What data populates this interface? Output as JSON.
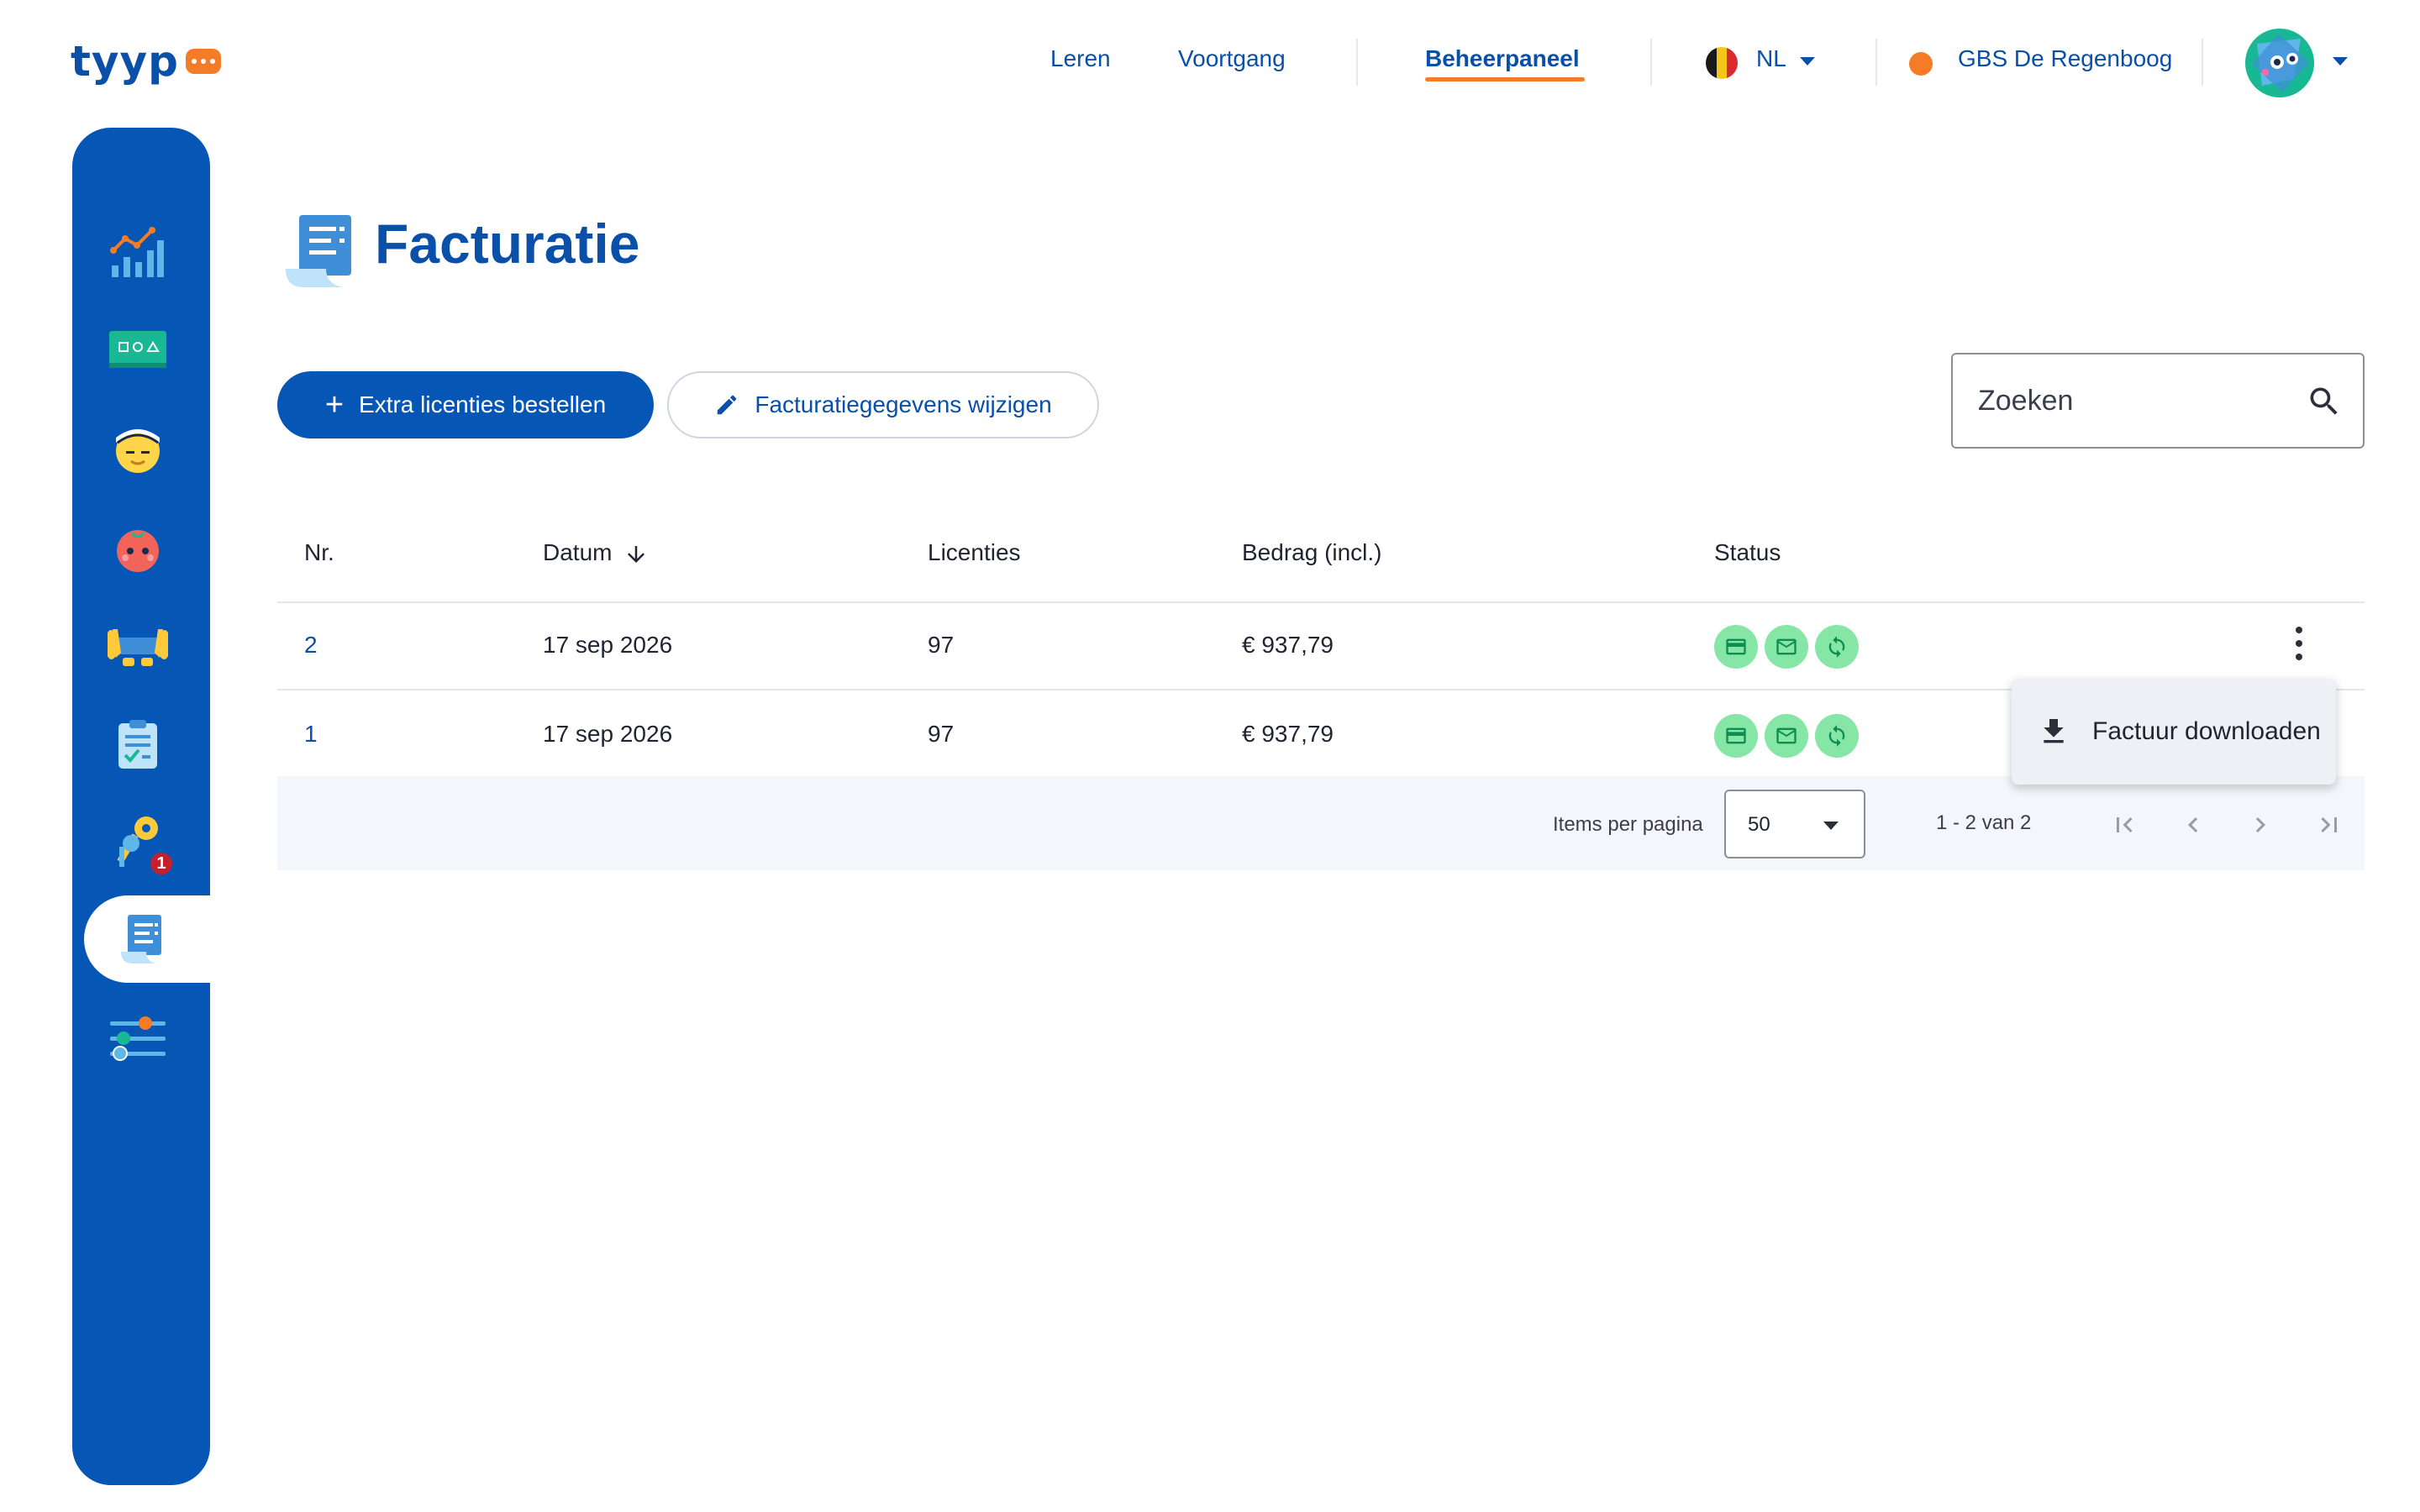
{
  "brand": {
    "name": "tyyp"
  },
  "nav": {
    "links": [
      "Leren",
      "Voortgang"
    ],
    "active": "Beheerpaneel",
    "language": "NL",
    "school": "GBS De Regenboog"
  },
  "sidebar": {
    "items": [
      {
        "name": "dashboard-icon"
      },
      {
        "name": "classroom-icon"
      },
      {
        "name": "student-icon"
      },
      {
        "name": "tomato-icon"
      },
      {
        "name": "hands-keyboard-icon"
      },
      {
        "name": "clipboard-icon"
      },
      {
        "name": "keys-icon",
        "badge": "1"
      },
      {
        "name": "invoice-icon",
        "active": true
      },
      {
        "name": "settings-sliders-icon"
      }
    ]
  },
  "page": {
    "title": "Facturatie"
  },
  "actions": {
    "order_label": "Extra licenties bestellen",
    "edit_label": "Facturatiegegevens wijzigen"
  },
  "search": {
    "placeholder": "Zoeken"
  },
  "table": {
    "columns": [
      "Nr.",
      "Datum",
      "Licenties",
      "Bedrag (incl.)",
      "Status"
    ],
    "rows": [
      {
        "nr": "2",
        "datum": "17 sep 2026",
        "licenties": "97",
        "bedrag": "€ 937,79"
      },
      {
        "nr": "1",
        "datum": "17 sep 2026",
        "licenties": "97",
        "bedrag": "€ 937,79"
      }
    ]
  },
  "paginator": {
    "items_label": "Items per pagina",
    "page_size": "50",
    "range": "1 - 2 van 2"
  },
  "menu": {
    "download_label": "Factuur downloaden"
  },
  "colors": {
    "primary": "#0656b5",
    "accent": "#f47c27",
    "status_green": "#86e6a6"
  }
}
